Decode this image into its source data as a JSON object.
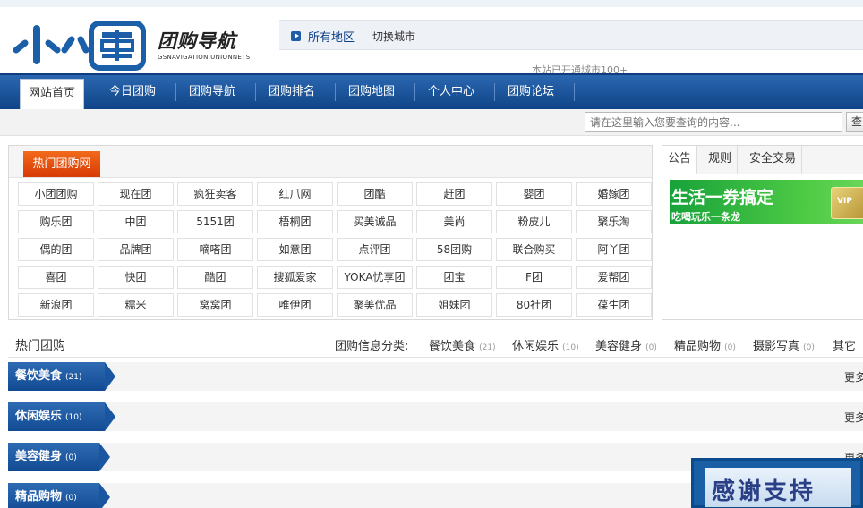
{
  "header": {
    "logo_title": "团购导航",
    "logo_sub": "GSNAVIGATION.UNIONNETS",
    "region": "所有地区",
    "switch_city": "切换城市",
    "cities_note": "本站已开通城市100+"
  },
  "nav": {
    "items": [
      {
        "label": "网站首页",
        "active": true
      },
      {
        "label": "今日团购"
      },
      {
        "label": "团购导航"
      },
      {
        "label": "团购排名"
      },
      {
        "label": "团购地图"
      },
      {
        "label": "个人中心"
      },
      {
        "label": "团购论坛"
      }
    ]
  },
  "search": {
    "placeholder": "请在这里输入您要查询的内容...",
    "button": "查"
  },
  "hot": {
    "title": "热门团购网",
    "sites": [
      "小团团购",
      "现在团",
      "疯狂卖客",
      "红爪网",
      "团酷",
      "赶团",
      "婴团",
      "婚嫁团",
      "购乐团",
      "中团",
      "5151团",
      "梧桐团",
      "买美诚品",
      "美尚",
      "粉皮儿",
      "聚乐淘",
      "偶的团",
      "品牌团",
      "嘀嗒团",
      "如意团",
      "点评团",
      "58团购",
      "联合购买",
      "阿丫团",
      "喜团",
      "快团",
      "酷团",
      "搜狐爱家",
      "YOKA忧享团",
      "团宝",
      "F团",
      "爱帮团",
      "新浪团",
      "糯米",
      "窝窝团",
      "唯伊团",
      "聚美优品",
      "姐妹团",
      "80社团",
      "葆生团"
    ]
  },
  "notice": {
    "tabs": [
      "公告",
      "规则",
      "安全交易"
    ],
    "banner_title": "生活一券搞定",
    "banner_sub": "吃喝玩乐一条龙",
    "banner_card": "VIP"
  },
  "categories": {
    "title": "热门团购",
    "label": "团购信息分类:",
    "items": [
      {
        "name": "餐饮美食",
        "count": "(21)"
      },
      {
        "name": "休闲娱乐",
        "count": "(10)"
      },
      {
        "name": "美容健身",
        "count": "(0)"
      },
      {
        "name": "精品购物",
        "count": "(0)"
      },
      {
        "name": "摄影写真",
        "count": "(0)"
      },
      {
        "name": "其它",
        "count": ""
      }
    ]
  },
  "sections": [
    {
      "name": "餐饮美食",
      "count": "(21)",
      "more": "更多"
    },
    {
      "name": "休闲娱乐",
      "count": "(10)",
      "more": "更多"
    },
    {
      "name": "美容健身",
      "count": "(0)",
      "more": "更多"
    },
    {
      "name": "精品购物",
      "count": "(0)",
      "more": ""
    }
  ],
  "thanks": "感谢支持",
  "colors": {
    "nav_blue": "#1a56a0",
    "hot_orange": "#e8520f",
    "link_blue": "#0d3f86",
    "banner_green": "#2fb43d"
  }
}
